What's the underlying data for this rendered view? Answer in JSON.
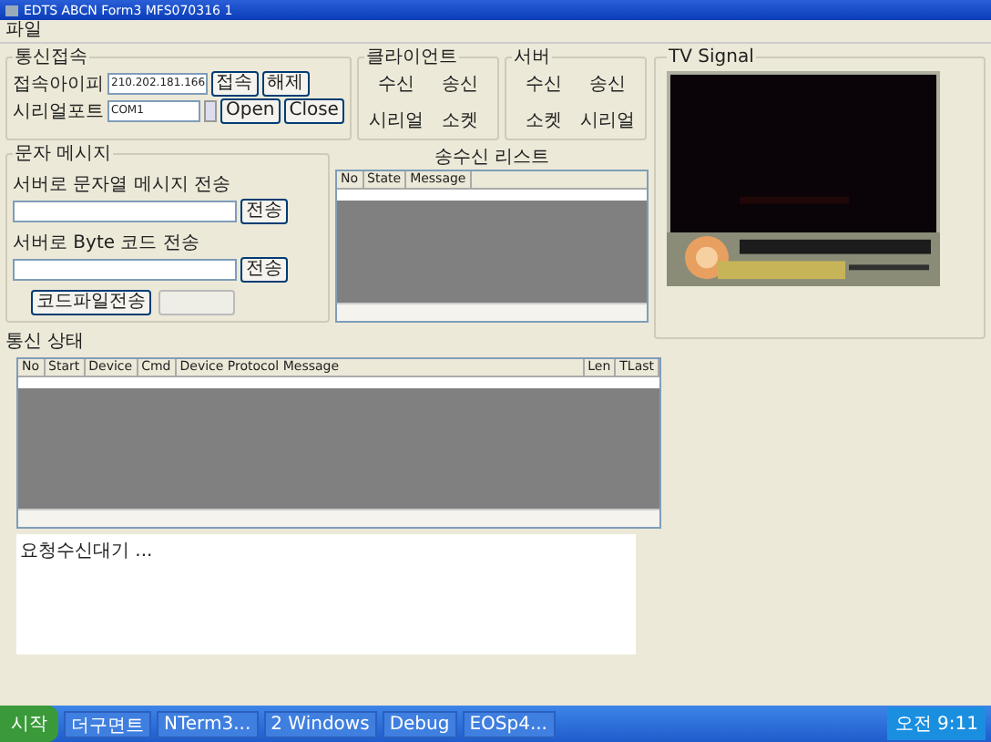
{
  "window": {
    "title": "EDTS ABCN Form3 MFS070316 1"
  },
  "menu": [
    "파일"
  ],
  "connection": {
    "title": "통신접속",
    "ip_label": "접속아이피",
    "ip_value": "210.202.181.166",
    "port_label": "시리얼포트",
    "port_value": "COM1",
    "buttons": [
      "접속",
      "해제",
      "Open",
      "Close"
    ]
  },
  "client": {
    "title": "클라이언트",
    "labels": [
      "수신",
      "송신",
      "시리얼",
      "소켓"
    ]
  },
  "server": {
    "title": "서버",
    "labels": [
      "수신",
      "송신",
      "소켓",
      "시리얼"
    ]
  },
  "message": {
    "title": "문자 메시지",
    "string_label": "서버로 문자열 메시지 전송",
    "byte_label": "서버로 Byte 코드 전송",
    "send_buttons": [
      "전송",
      "전송"
    ],
    "file_button": "코드파일전송"
  },
  "send_list": {
    "title": "송수신 리스트",
    "columns": [
      "No",
      "State",
      "Message"
    ]
  },
  "status": {
    "title": "통신 상태",
    "columns": [
      "No",
      "Start",
      "Device",
      "Cmd",
      "Device Protocol Message",
      "Len",
      "TLast"
    ]
  },
  "log": {
    "text": "요청수신대기 ..."
  },
  "tv": {
    "title": "TV Signal"
  },
  "taskbar": {
    "start": "시작",
    "tasks": [
      "더구면트",
      "NTerm3...",
      "2 Windows",
      "Debug",
      "EOSp4..."
    ],
    "clock": "오전 9:11"
  }
}
